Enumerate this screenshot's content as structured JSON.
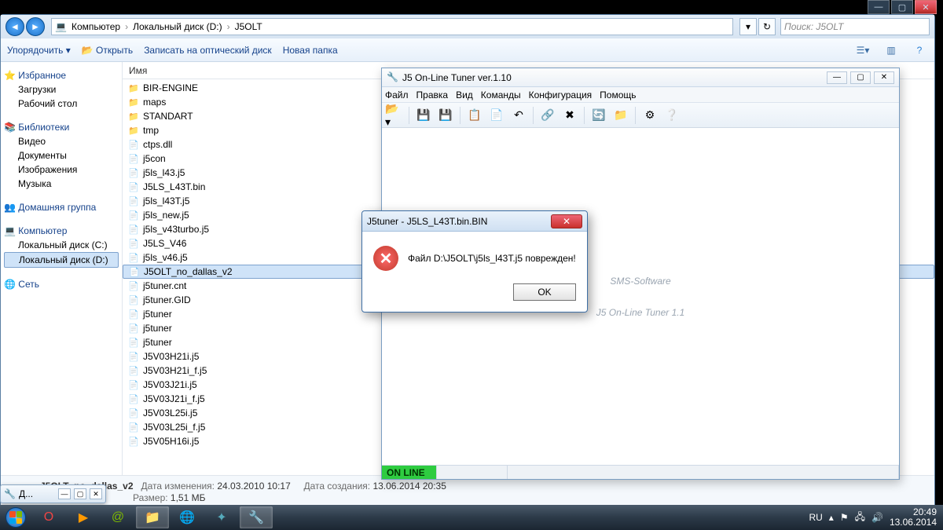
{
  "explorer": {
    "breadcrumb": [
      "Компьютер",
      "Локальный диск (D:)",
      "J5OLT"
    ],
    "search_placeholder": "Поиск: J5OLT",
    "toolbar": {
      "organize": "Упорядочить ▾",
      "open": "Открыть",
      "burn": "Записать на оптический диск",
      "newfolder": "Новая папка"
    },
    "list_header": "Имя",
    "sidebar": {
      "favorites": "Избранное",
      "favorites_items": [
        "Загрузки",
        "Рабочий стол"
      ],
      "libraries": "Библиотеки",
      "libraries_items": [
        "Видео",
        "Документы",
        "Изображения",
        "Музыка"
      ],
      "homegroup": "Домашняя группа",
      "computer": "Компьютер",
      "computer_items": [
        "Локальный диск (C:)",
        "Локальный диск (D:)"
      ],
      "network": "Сеть"
    },
    "files": [
      {
        "n": "BIR-ENGINE",
        "t": "folder"
      },
      {
        "n": "maps",
        "t": "folder"
      },
      {
        "n": "STANDART",
        "t": "folder"
      },
      {
        "n": "tmp",
        "t": "folder"
      },
      {
        "n": "ctps.dll",
        "t": "generic"
      },
      {
        "n": "j5con",
        "t": "generic"
      },
      {
        "n": "j5ls_l43.j5",
        "t": "generic"
      },
      {
        "n": "J5LS_L43T.bin",
        "t": "generic"
      },
      {
        "n": "j5ls_l43T.j5",
        "t": "generic"
      },
      {
        "n": "j5ls_new.j5",
        "t": "generic"
      },
      {
        "n": "j5ls_v43turbo.j5",
        "t": "generic"
      },
      {
        "n": "J5LS_V46",
        "t": "generic"
      },
      {
        "n": "j5ls_v46.j5",
        "t": "generic"
      },
      {
        "n": "J5OLT_no_dallas_v2",
        "t": "generic",
        "sel": true
      },
      {
        "n": "j5tuner.cnt",
        "t": "generic"
      },
      {
        "n": "j5tuner.GID",
        "t": "generic"
      },
      {
        "n": "j5tuner",
        "t": "generic"
      },
      {
        "n": "j5tuner",
        "t": "generic"
      },
      {
        "n": "j5tuner",
        "t": "generic"
      },
      {
        "n": "J5V03H21i.j5",
        "t": "generic"
      },
      {
        "n": "J5V03H21i_f.j5",
        "t": "generic"
      },
      {
        "n": "J5V03J21i.j5",
        "t": "generic"
      },
      {
        "n": "J5V03J21i_f.j5",
        "t": "generic"
      },
      {
        "n": "J5V03L25i.j5",
        "t": "generic"
      },
      {
        "n": "J5V03L25i_f.j5",
        "t": "generic"
      },
      {
        "n": "J5V05H16i.j5",
        "t": "generic"
      }
    ],
    "details": {
      "name": "J5OLT_no_dallas_v2",
      "mod_label": "Дата изменения:",
      "mod_value": "24.03.2010 10:17",
      "created_label": "Дата создания:",
      "created_value": "13.06.2014 20:35",
      "size_label": "Размер:",
      "size_value": "1,51 МБ"
    }
  },
  "tuner": {
    "title": "J5 On-Line Tuner ver.1.10",
    "menu": [
      "Файл",
      "Правка",
      "Вид",
      "Команды",
      "Конфигурация",
      "Помощь"
    ],
    "watermark_1": "SMS-Software",
    "watermark_2": "J5 On-Line Tuner 1.1",
    "status_online": "ON LINE"
  },
  "dialog": {
    "title": "J5tuner - J5LS_L43T.bin.BIN",
    "message": "Файл D:\\J5OLT\\j5ls_l43T.j5 поврежден!",
    "ok": "OK"
  },
  "taskbar": {
    "lang": "RU",
    "time": "20:49",
    "date": "13.06.2014"
  },
  "preview_label": "Д..."
}
